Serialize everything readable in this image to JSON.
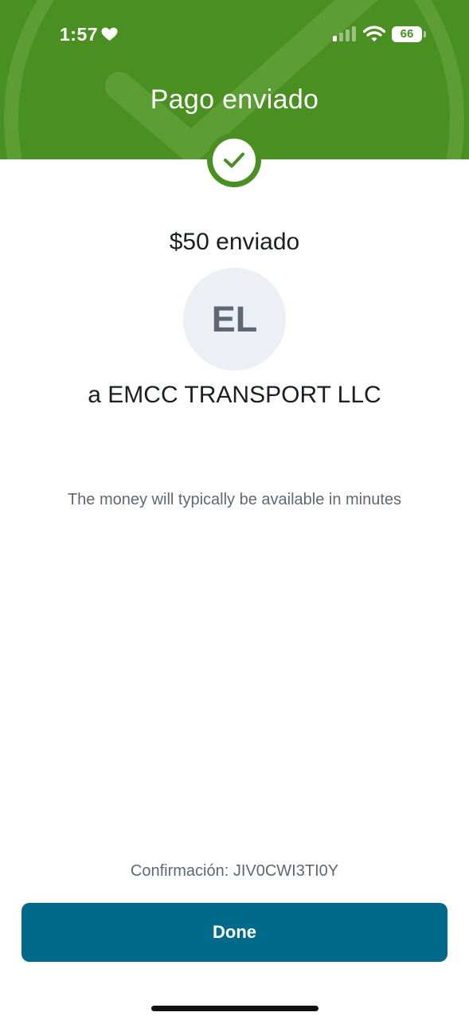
{
  "status_bar": {
    "time": "1:57",
    "battery_level": "66"
  },
  "header": {
    "title": "Pago enviado"
  },
  "payment": {
    "amount_sent": "$50 enviado",
    "recipient_initials": "EL",
    "recipient": "a EMCC TRANSPORT LLC",
    "availability_note": "The money will typically be available in minutes",
    "confirmation": "Confirmación: JIV0CWI3TI0Y"
  },
  "actions": {
    "done_label": "Done"
  },
  "icons": {
    "status_heart": "heart-icon",
    "signal": "signal-icon",
    "wifi": "wifi-icon",
    "success": "check-icon"
  },
  "colors": {
    "header_green": "#4a8f22",
    "button_teal": "#006a8a",
    "text_dark": "#1a1f24",
    "text_muted": "#5e6873",
    "avatar_bg": "#eceff3"
  }
}
